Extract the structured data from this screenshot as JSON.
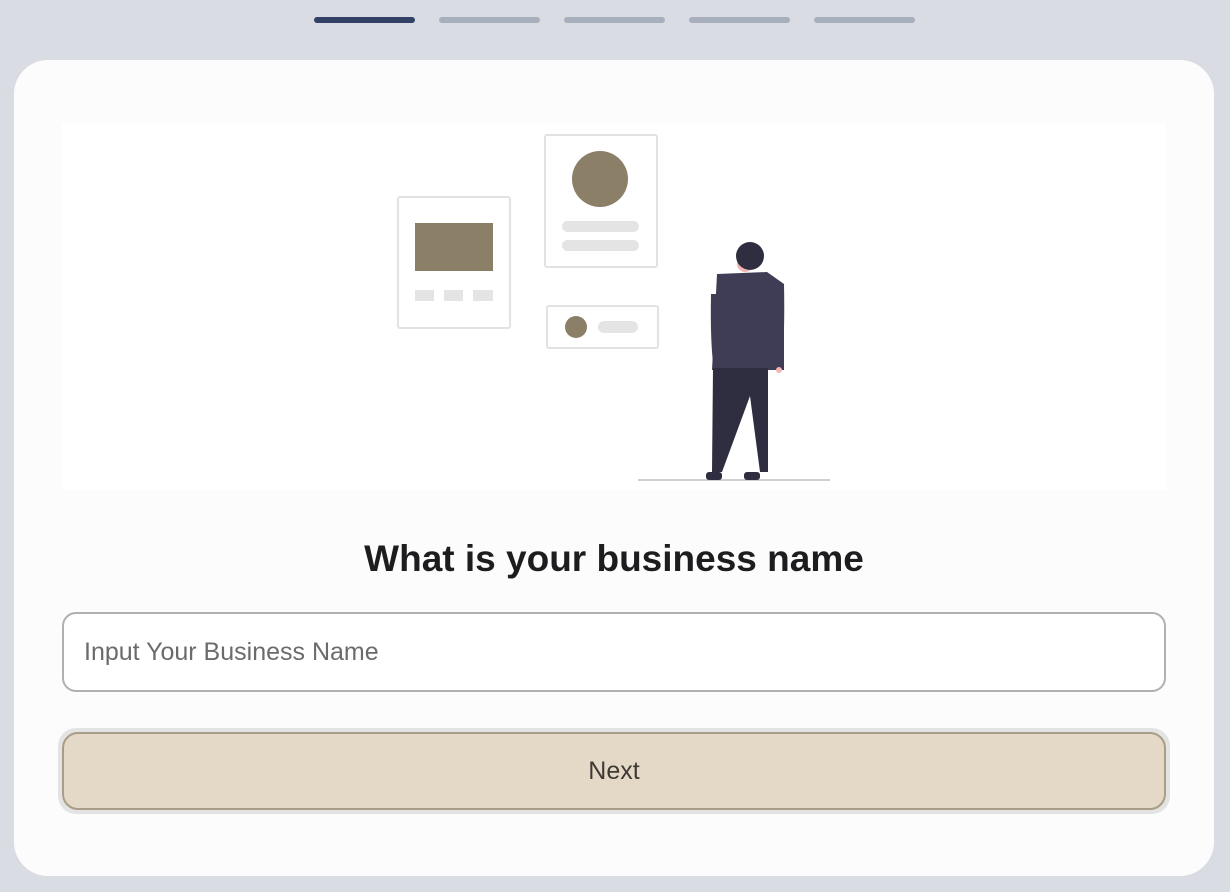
{
  "progress": {
    "current_step": 1,
    "total_steps": 5
  },
  "question": {
    "title": "What is your business name"
  },
  "business_name_input": {
    "value": "",
    "placeholder": "Input Your Business Name"
  },
  "next_button": {
    "label": "Next"
  },
  "colors": {
    "active_step": "#344166",
    "inactive_step": "#a8afbc",
    "button_bg": "#e4d9c7",
    "accent": "#8b7f68"
  }
}
